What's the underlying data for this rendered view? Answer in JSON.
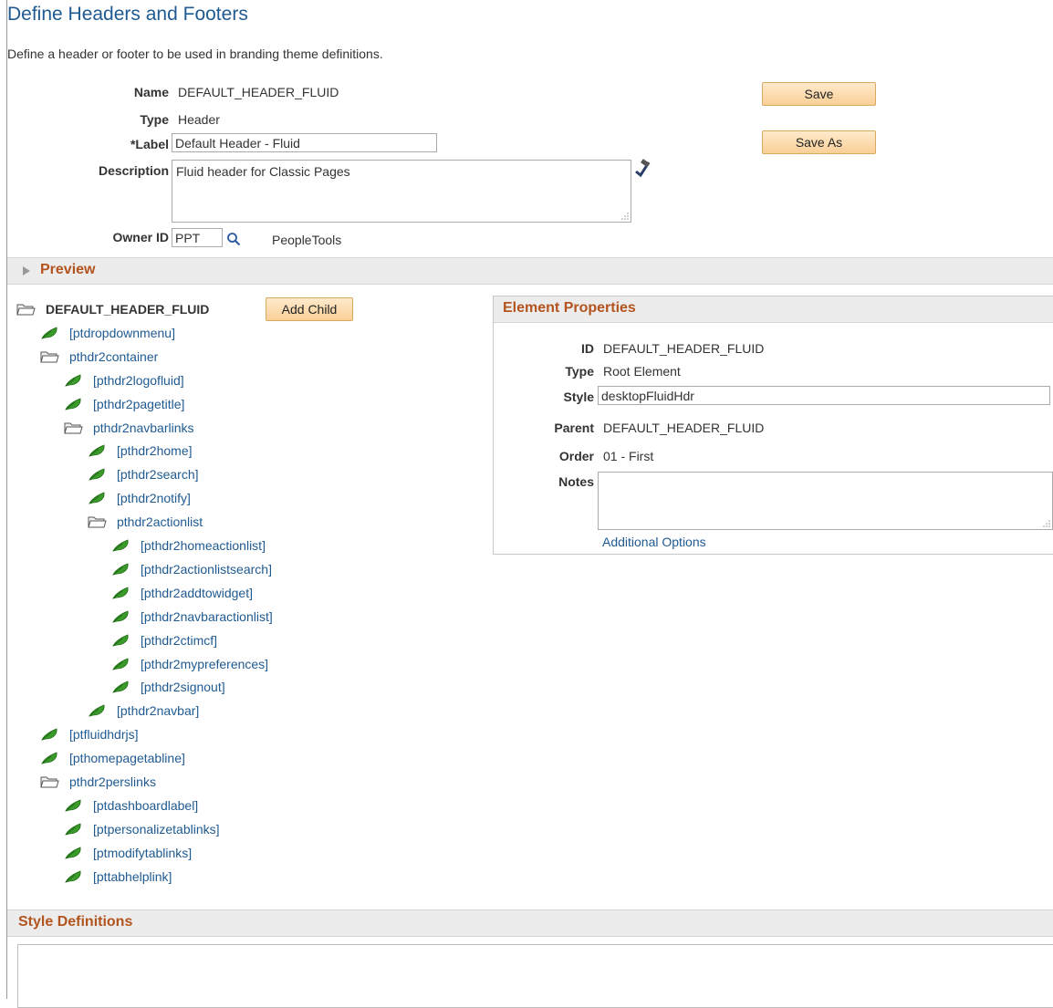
{
  "page": {
    "title": "Define Headers and Footers",
    "description": "Define a header or footer to be used in branding theme definitions."
  },
  "form": {
    "name_label": "Name",
    "name_value": "DEFAULT_HEADER_FLUID",
    "type_label": "Type",
    "type_value": "Header",
    "label_label": "*Label",
    "label_value": "Default Header - Fluid",
    "description_label": "Description",
    "description_value": "Fluid header for Classic Pages",
    "owner_label": "Owner ID",
    "owner_value": "PPT",
    "owner_desc": "PeopleTools",
    "save_button": "Save",
    "save_as_button": "Save As"
  },
  "preview": {
    "label": "Preview"
  },
  "tree": {
    "add_child_button": "Add Child",
    "nodes": [
      {
        "label": "DEFAULT_HEADER_FLUID",
        "kind": "root",
        "level": 0
      },
      {
        "label": "[ptdropdownmenu]",
        "kind": "leaf",
        "level": 1
      },
      {
        "label": "pthdr2container",
        "kind": "folder",
        "level": 1
      },
      {
        "label": "[pthdr2logofluid]",
        "kind": "leaf",
        "level": 2
      },
      {
        "label": "[pthdr2pagetitle]",
        "kind": "leaf",
        "level": 2
      },
      {
        "label": "pthdr2navbarlinks",
        "kind": "folder",
        "level": 2
      },
      {
        "label": "[pthdr2home]",
        "kind": "leaf",
        "level": 3
      },
      {
        "label": "[pthdr2search]",
        "kind": "leaf",
        "level": 3
      },
      {
        "label": "[pthdr2notify]",
        "kind": "leaf",
        "level": 3
      },
      {
        "label": "pthdr2actionlist",
        "kind": "folder",
        "level": 3
      },
      {
        "label": "[pthdr2homeactionlist]",
        "kind": "leaf",
        "level": 4
      },
      {
        "label": "[pthdr2actionlistsearch]",
        "kind": "leaf",
        "level": 4
      },
      {
        "label": "[pthdr2addtowidget]",
        "kind": "leaf",
        "level": 4
      },
      {
        "label": "[pthdr2navbaractionlist]",
        "kind": "leaf",
        "level": 4
      },
      {
        "label": "[pthdr2ctimcf]",
        "kind": "leaf",
        "level": 4
      },
      {
        "label": "[pthdr2mypreferences]",
        "kind": "leaf",
        "level": 4
      },
      {
        "label": "[pthdr2signout]",
        "kind": "leaf",
        "level": 4
      },
      {
        "label": "[pthdr2navbar]",
        "kind": "leaf",
        "level": 3
      },
      {
        "label": "[ptfluidhdrjs]",
        "kind": "leaf",
        "level": 1
      },
      {
        "label": "[pthomepagetabline]",
        "kind": "leaf",
        "level": 1
      },
      {
        "label": "pthdr2perslinks",
        "kind": "folder",
        "level": 1
      },
      {
        "label": "[ptdashboardlabel]",
        "kind": "leaf",
        "level": 2
      },
      {
        "label": "[ptpersonalizetablinks]",
        "kind": "leaf",
        "level": 2
      },
      {
        "label": "[ptmodifytablinks]",
        "kind": "leaf",
        "level": 2
      },
      {
        "label": "[pttabhelplink]",
        "kind": "leaf",
        "level": 2
      }
    ]
  },
  "element_properties": {
    "title": "Element Properties",
    "id_label": "ID",
    "id_value": "DEFAULT_HEADER_FLUID",
    "type_label": "Type",
    "type_value": "Root Element",
    "style_label": "Style",
    "style_value": "desktopFluidHdr",
    "parent_label": "Parent",
    "parent_value": "DEFAULT_HEADER_FLUID",
    "order_label": "Order",
    "order_value": "01 - First",
    "notes_label": "Notes",
    "notes_value": "",
    "additional_options": "Additional Options"
  },
  "style_definitions": {
    "title": "Style Definitions"
  },
  "colors": {
    "title_blue": "#1f5a91",
    "section_orange": "#b3541e",
    "button_fill": "#f9cf97",
    "leaf_green": "#3a9a2a"
  }
}
